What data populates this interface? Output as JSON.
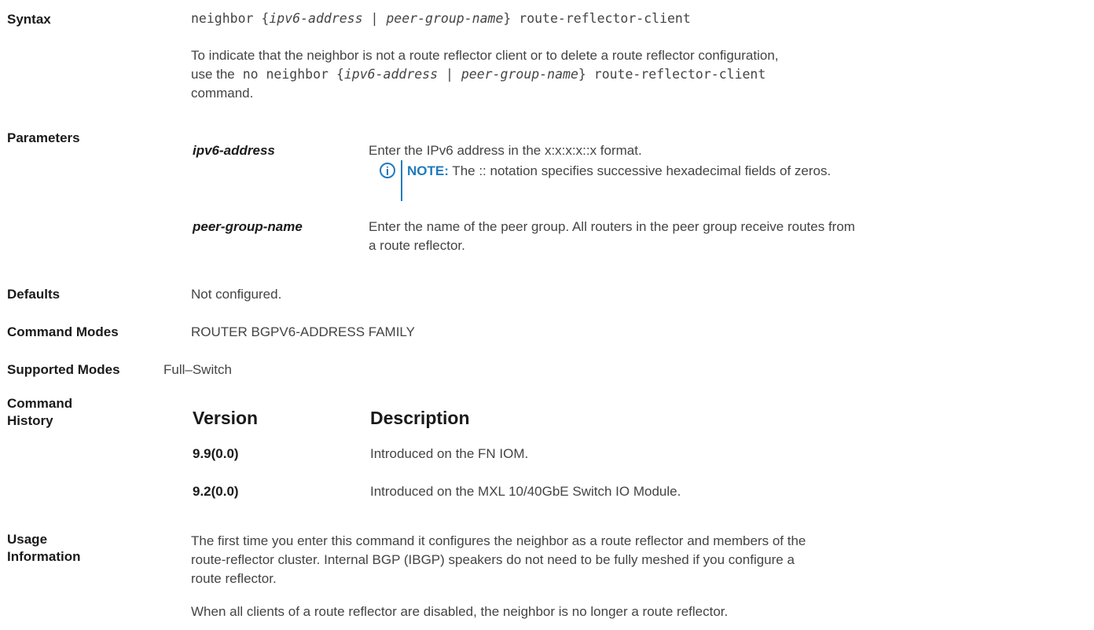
{
  "syntax": {
    "label": "Syntax",
    "cmd_prefix": "neighbor {",
    "cmd_arg1": "ipv6-address",
    "cmd_sep": " | ",
    "cmd_arg2": "peer-group-name",
    "cmd_suffix": "} route-reflector-client",
    "desc_line1": "To indicate that the neighbor is not a route reflector client or to delete a route reflector configuration,",
    "desc_line2_text": "use the",
    "desc_line2_cmd_prefix": " no neighbor {",
    "desc_line2_arg1": "ipv6-address",
    "desc_line2_sep": " | ",
    "desc_line2_arg2": "peer-group-name",
    "desc_line2_suffix": "} route-reflector-client",
    "desc_line3": "command."
  },
  "parameters": {
    "label": "Parameters",
    "items": [
      {
        "term": "ipv6-address",
        "desc": "Enter the IPv6 address in the x:x:x:x::x format."
      },
      {
        "term": "peer-group-name",
        "desc_line1": "Enter the name of the peer group. All routers in the peer group receive routes from",
        "desc_line2": "a route reflector."
      }
    ],
    "note_label": "NOTE:",
    "note_text": " The :: notation specifies successive hexadecimal fields of zeros.",
    "note_icon": "i"
  },
  "defaults": {
    "label": "Defaults",
    "value": "Not configured."
  },
  "command_modes": {
    "label": "Command Modes",
    "value": "ROUTER BGPV6-ADDRESS FAMILY"
  },
  "supported_modes": {
    "label": "Supported Modes",
    "value": "Full–Switch"
  },
  "history": {
    "label_line1": "Command",
    "label_line2": "History",
    "col_version": "Version",
    "col_description": "Description",
    "rows": [
      {
        "version": "9.9(0.0)",
        "description": "Introduced on the FN IOM."
      },
      {
        "version": "9.2(0.0)",
        "description": "Introduced on the MXL 10/40GbE Switch IO Module."
      }
    ]
  },
  "usage": {
    "label_line1": "Usage",
    "label_line2": "Information",
    "p1_line1": "The first time you enter this command it configures the neighbor as a route reflector and members of the",
    "p1_line2": "route-reflector cluster. Internal BGP (IBGP) speakers do not need to be fully meshed if you configure a",
    "p1_line3": "route reflector.",
    "p2": "When all clients of a route reflector are disabled, the neighbor is no longer a route reflector."
  }
}
